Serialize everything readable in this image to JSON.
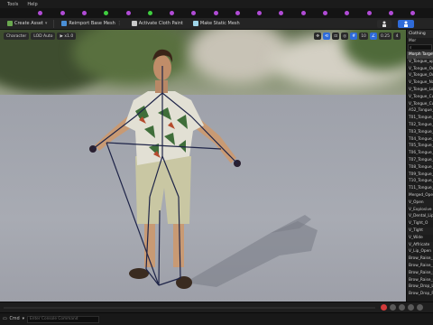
{
  "menu": {
    "tools": "Tools",
    "help": "Help"
  },
  "toolbar": {
    "create_asset": "Create Asset",
    "reimport_base_mesh": "Reimport Base Mesh",
    "activate_cloth_paint": "Activate Cloth Paint",
    "make_static_mesh": "Make Static Mesh"
  },
  "viewport": {
    "character": "Character",
    "lod_auto": "LOD Auto",
    "play_speed": "x1.0",
    "snap_value": "10",
    "angle_value": "0.25",
    "cam_speed": "4"
  },
  "panel": {
    "header": "Clothing",
    "subheader": "Mor",
    "search_placeholder": "",
    "items": [
      "Morph Targets",
      "V_Tongue_up",
      "V_Tongue_Ou",
      "V_Tongue_Ou",
      "V_Tongue_Na",
      "V_Tongue_Lo",
      "V_Tongue_Cu",
      "V_Tongue_Cu",
      "A52_Tongue_",
      "T01_Tongue_",
      "T02_Tongue_",
      "T03_Tongue_",
      "T04_Tongue_",
      "T05_Tongue_",
      "T06_Tongue_",
      "T07_Tongue_",
      "T08_Tongue_",
      "T09_Tongue_",
      "T10_Tongue_",
      "T11_Tongue_",
      "Merged_Open",
      "V_Open",
      "V_Explosive",
      "V_Dental_Lip",
      "V_Tight_O",
      "V_Tight",
      "V_Wide",
      "V_Affricate",
      "V_Lip_Open",
      "Brow_Raise_I",
      "Brow_Raise_I",
      "Brow_Raise_O",
      "Brow_Raise_O",
      "Brow_Drop_L",
      "Brow_Drop_R"
    ]
  },
  "statusbar": {
    "cmd": "Cmd",
    "console_placeholder": "Enter Console Command"
  },
  "colors": {
    "accent_blue": "#2f6bd8",
    "tab_purple": "#b14bd6",
    "tab_green": "#3fcf3f",
    "record_red": "#d23a3a"
  },
  "icons": {
    "create_asset": "plus-icon",
    "reimport": "reimport-icon",
    "cloth": "cloth-paint-icon",
    "static_mesh": "cube-icon"
  }
}
